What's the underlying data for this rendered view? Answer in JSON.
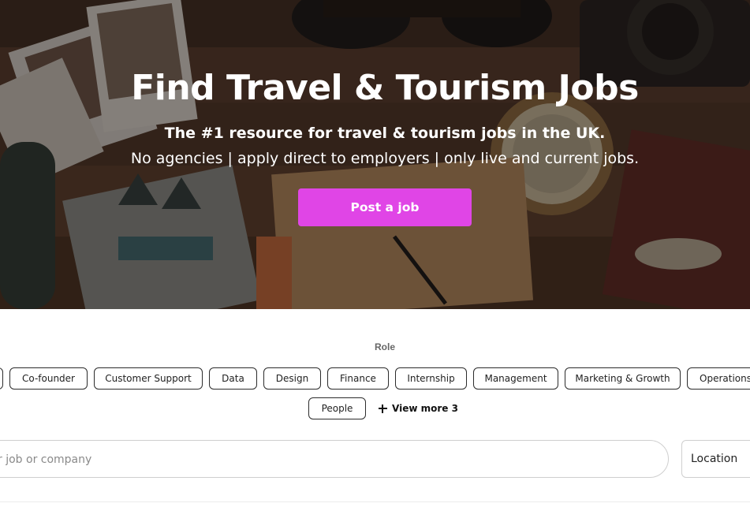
{
  "hero": {
    "title": "Find Travel & Tourism Jobs",
    "subtitle": "The #1 resource for travel & tourism jobs in the UK.",
    "tagline": "No agencies | apply direct to employers | only live and current jobs.",
    "post_button": "Post a job",
    "accent": "#e045e6"
  },
  "roles": {
    "label": "Role",
    "chips": [
      "",
      "Co-founder",
      "Customer Support",
      "Data",
      "Design",
      "Finance",
      "Internship",
      "Management",
      "Marketing & Growth",
      "Operations",
      "People"
    ],
    "view_more": "View more 3"
  },
  "search": {
    "placeholder": "r job or company",
    "location_label": "Location"
  }
}
